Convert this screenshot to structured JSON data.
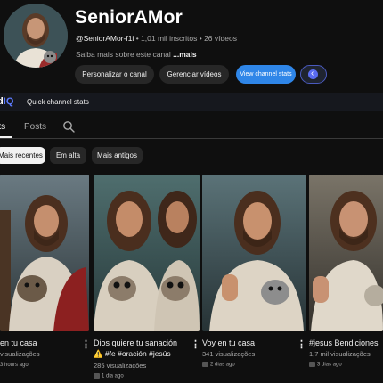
{
  "channel": {
    "name": "SeniorAMor",
    "handle": "@SeniorAMor-f1i",
    "subscribers": "1,01 mil inscritos",
    "videos_count": "26 vídeos",
    "about_prefix": "Saiba mais sobre este canal",
    "about_more": "...mais"
  },
  "actions": {
    "customize": "Personalizar o canal",
    "manage": "Gerenciar vídeos",
    "stats": "View channel stats"
  },
  "vidiq": {
    "logo_prefix": "vid",
    "logo_suffix": "IQ",
    "quick_stats": "Quick channel stats"
  },
  "tabs": [
    {
      "label": "Vídeos",
      "visible_text": "rts",
      "active": true
    },
    {
      "label": "Posts",
      "active": false
    }
  ],
  "chips": [
    {
      "label": "Mais recentes",
      "active": true
    },
    {
      "label": "Em alta",
      "active": false
    },
    {
      "label": "Mais antigos",
      "active": false
    }
  ],
  "videos": [
    {
      "title": "en tu casa",
      "views": "visualizações",
      "time": "3 hours ago"
    },
    {
      "title": "Dios quiere tu sanación",
      "title2": "⚠️ #fe #oración #jesús",
      "views": "285 visualizações",
      "time": "1 dia ago"
    },
    {
      "title": "Voy en tu casa",
      "views": "341 visualizações",
      "time": "2 dias ago"
    },
    {
      "title": "#jesus Bendiciones",
      "views": "1,7 mil visualizações",
      "time": "3 dias ago"
    }
  ],
  "colors": {
    "background": "#0f0f0f",
    "accent": "#2f86e8",
    "vidiq": "#5d7bff"
  }
}
